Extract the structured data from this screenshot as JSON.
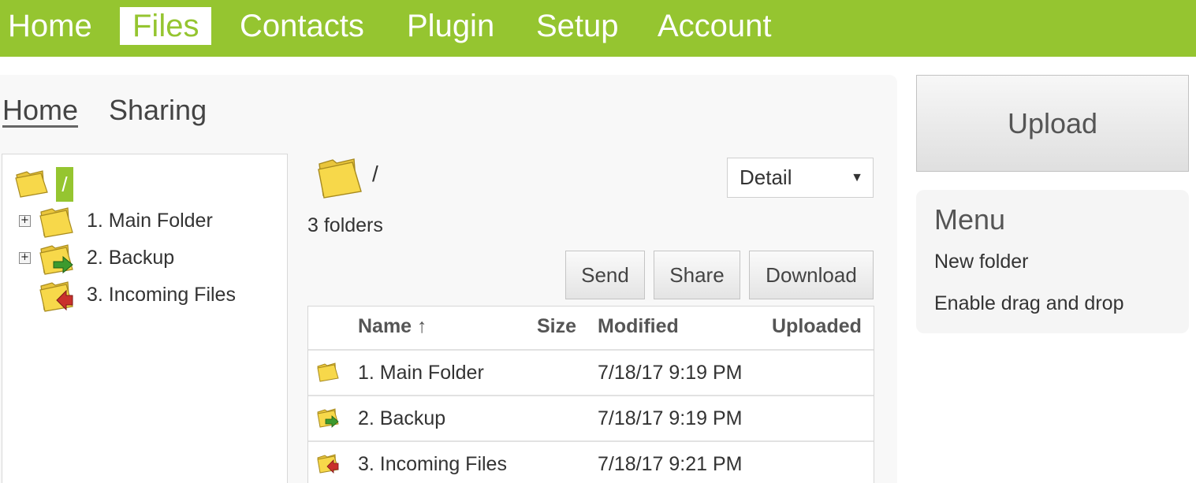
{
  "nav": {
    "items": [
      "Home",
      "Files",
      "Contacts",
      "Plugin",
      "Setup",
      "Account"
    ],
    "active": "Files"
  },
  "subtabs": [
    "Home",
    "Sharing"
  ],
  "tree": {
    "root_label": "/",
    "items": [
      {
        "label": "1. Main Folder",
        "expander": "+",
        "icon": "folder-icon"
      },
      {
        "label": "2. Backup",
        "expander": "+",
        "icon": "folder-backup-icon"
      },
      {
        "label": "3. Incoming Files",
        "expander": "",
        "icon": "folder-incoming-icon"
      }
    ]
  },
  "content": {
    "path": "/",
    "count": "3 folders",
    "view_select": "Detail",
    "buttons": [
      "Send",
      "Share",
      "Download"
    ],
    "columns": [
      "Name ↑",
      "Size",
      "Modified",
      "Uploaded"
    ],
    "rows": [
      {
        "name": "1. Main Folder",
        "size": "",
        "modified": "7/18/17 9:19 PM",
        "uploaded": "",
        "icon": "folder-icon"
      },
      {
        "name": "2. Backup",
        "size": "",
        "modified": "7/18/17 9:19 PM",
        "uploaded": "",
        "icon": "folder-backup-icon"
      },
      {
        "name": "3. Incoming Files",
        "size": "",
        "modified": "7/18/17 9:21 PM",
        "uploaded": "",
        "icon": "folder-incoming-icon"
      }
    ]
  },
  "sidebar": {
    "upload_label": "Upload",
    "menu_title": "Menu",
    "menu_items": [
      "New folder",
      "Enable drag and drop"
    ]
  },
  "colors": {
    "accent": "#95c530",
    "folder": "#f7d84a",
    "backup_arrow": "#3c9a2e",
    "incoming_arrow": "#c9302c"
  }
}
